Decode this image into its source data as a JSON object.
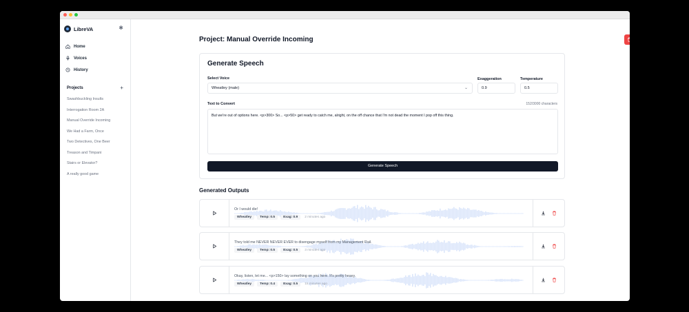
{
  "app": {
    "name": "LibreVA"
  },
  "colors": {
    "accent": "#111827",
    "danger": "#ef4444",
    "wave": "#dbe6fb"
  },
  "nav": [
    {
      "label": "Home",
      "icon": "home-icon"
    },
    {
      "label": "Voices",
      "icon": "mic-icon"
    },
    {
      "label": "History",
      "icon": "history-icon"
    }
  ],
  "projects": {
    "title": "Projects",
    "items": [
      "Swashbuckling Insults",
      "Interrogation Room 2A",
      "Manual Override Incoming",
      "We Had a Farm, Once",
      "Two Detectives, One Beer",
      "Treason and Timpani",
      "Stairs or Elevator?",
      "A really good game"
    ]
  },
  "page": {
    "title": "Project: Manual Override Incoming"
  },
  "generate": {
    "title": "Generate Speech",
    "voice_label": "Select Voice",
    "voice_value": "Wheatley (male)",
    "exag_label": "Exaggeration",
    "exag_value": "0.9",
    "temp_label": "Temperature",
    "temp_value": "0.5",
    "text_label": "Text to Convert",
    "char_count": "152/3000 characters",
    "text_value": "But we're out of options here. <p>300> So... <p>50> get ready to catch me, alright, on the off chance that I'm not dead the moment I pop off this thing.",
    "button": "Generate Speech"
  },
  "outputs": {
    "title": "Generated Outputs",
    "items": [
      {
        "text": "Or I would die!",
        "voice": "Wheatley",
        "temp": "Temp: 0.5",
        "exag": "Exag: 0.9",
        "ago": "2 minutes ago"
      },
      {
        "text": "They told me NEVER NEVER EVER to disengage myself from my Management Rail.",
        "voice": "Wheatley",
        "temp": "Temp: 0.5",
        "exag": "Exag: 0.5",
        "ago": "3 minutes ago"
      },
      {
        "text": "Okay, listen, let me... <p>150> lay something on you here. It's pretty heavy.",
        "voice": "Wheatley",
        "temp": "Temp: 0.4",
        "exag": "Exag: 0.5",
        "ago": "15 minutes ago"
      }
    ]
  }
}
